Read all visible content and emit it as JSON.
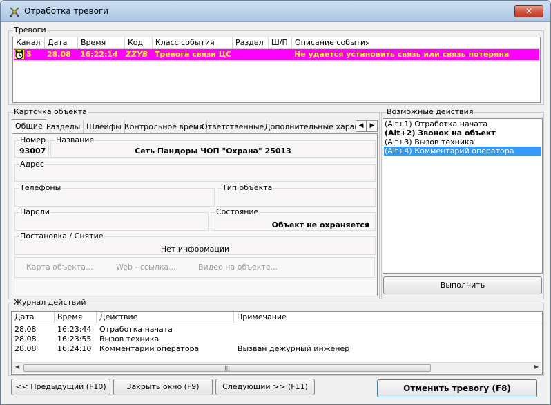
{
  "window": {
    "title": "Отработка тревоги",
    "close_glyph": "✕"
  },
  "alarms": {
    "group_label": "Тревоги",
    "columns": [
      "Канал",
      "Дата",
      "Время",
      "Код",
      "Класс события",
      "Раздел",
      "Ш/П",
      "Описание события"
    ],
    "rows": [
      {
        "icon": "alarm-clock-icon",
        "channel": "5",
        "date": "28.08",
        "time": "16:22:14",
        "code": "ZZYB",
        "event_class": "Тревога связи ЦС",
        "section": "",
        "zone": "",
        "description": "Не удается установить связь или связь потеряна"
      }
    ],
    "row_bg": "#ff00ff",
    "row_fg": "#ffff00"
  },
  "card": {
    "group_label": "Карточка объекта",
    "tabs": [
      "Общие",
      "Разделы",
      "Шлейфы",
      "Контрольное время",
      "Ответственные",
      "Дополнительные характе"
    ],
    "active_tab": "Общие",
    "fields": {
      "number_label": "Номер",
      "number_value": "93007",
      "name_label": "Название",
      "name_value": "Сеть Пандоры ЧОП \"Охрана\" 25013",
      "address_label": "Адрес",
      "address_value": "",
      "phones_label": "Телефоны",
      "phones_value": "",
      "object_type_label": "Тип объекта",
      "object_type_value": "",
      "passwords_label": "Пароли",
      "passwords_value": "",
      "state_label": "Состояние",
      "state_value": "Объект не охраняется",
      "arming_label": "Постановка / Снятие",
      "arming_value": "Нет информации"
    },
    "links": [
      "Карта объекта...",
      "Web - ссылка...",
      "Видео на объекте..."
    ]
  },
  "actions": {
    "group_label": "Возможные действия",
    "items": [
      {
        "label": "(Alt+1) Отработка начата",
        "bold": false,
        "selected": false
      },
      {
        "label": "(Alt+2) Звонок на объект",
        "bold": true,
        "selected": false
      },
      {
        "label": "(Alt+3) Вызов техника",
        "bold": false,
        "selected": false
      },
      {
        "label": "(Alt+4) Комментарий оператора",
        "bold": false,
        "selected": true
      }
    ],
    "execute_label": "Выполнить"
  },
  "log": {
    "group_label": "Журнал действий",
    "columns": [
      "Дата",
      "Время",
      "Действие",
      "Примечание"
    ],
    "rows": [
      {
        "date": "28.08",
        "time": "16:23:44",
        "action": "Отработка начата",
        "note": ""
      },
      {
        "date": "28.08",
        "time": "16:23:55",
        "action": "Вызов техника",
        "note": ""
      },
      {
        "date": "28.08",
        "time": "16:24:10",
        "action": "Комментарий оператора",
        "note": "Вызван дежурный инженер"
      }
    ]
  },
  "buttons": {
    "prev": "<< Предыдущий (F10)",
    "close": "Закрыть окно (F9)",
    "next": "Следующий >> (F11)",
    "cancel_alarm": "Отменить тревогу (F8)"
  }
}
